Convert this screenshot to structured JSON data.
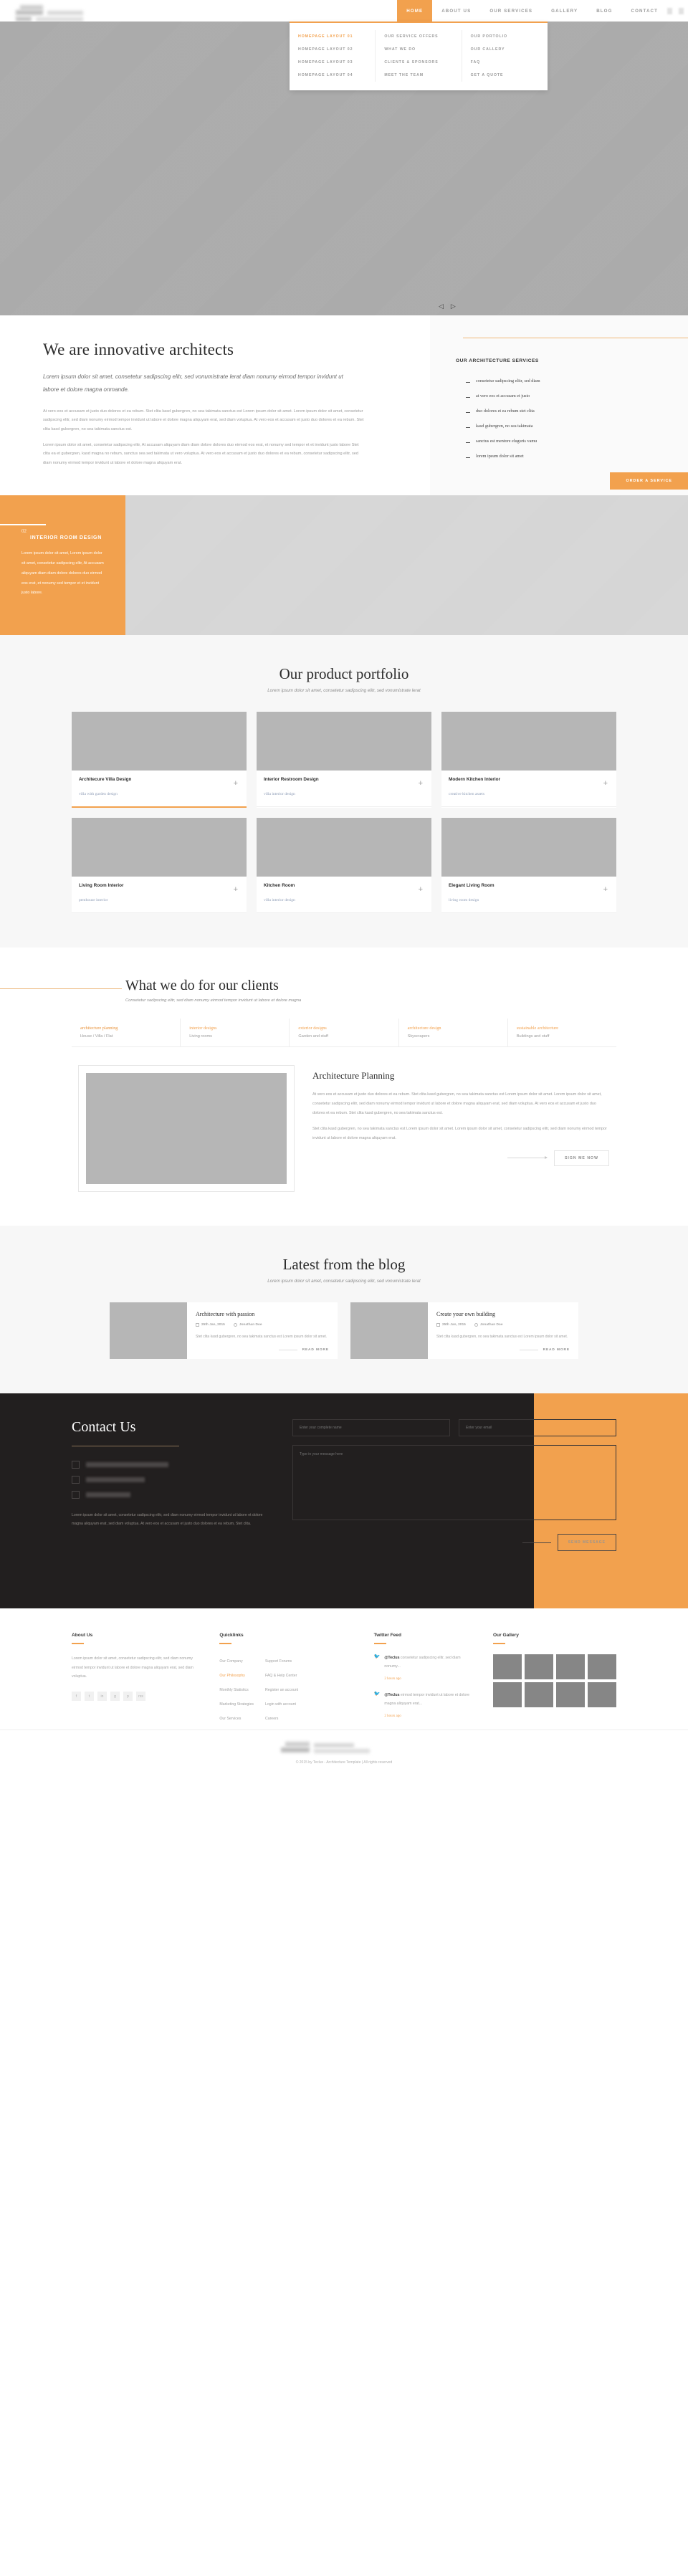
{
  "nav": {
    "items": [
      {
        "label": "HOME",
        "active": true
      },
      {
        "label": "ABOUT US",
        "active": false
      },
      {
        "label": "OUR SERVICES",
        "active": false
      },
      {
        "label": "GALLERY",
        "active": false
      },
      {
        "label": "BLOG",
        "active": false
      },
      {
        "label": "CONTACT",
        "active": false
      }
    ],
    "mega": {
      "col1": [
        "HOMEPAGE LAYOUT 01",
        "HOMEPAGE LAYOUT 02",
        "HOMEPAGE LAYOUT 03",
        "HOMEPAGE LAYOUT 04"
      ],
      "col2": [
        "OUR SERVICE OFFERS",
        "WHAT WE DO",
        "CLIENTS & SPONSORS",
        "MEET THE TEAM"
      ],
      "col3": [
        "OUR PORTOLIO",
        "OUR CALLERY",
        "FAQ",
        "GET A QUOTE"
      ]
    }
  },
  "intro": {
    "title": "We are innovative architects",
    "lead": "Lorem ipsum dolor sit amet, consetetur sadipscing elitr, sed vonumistrate lerat diam nonumy eirmod tempor invidunt ut labore et dolore magna onmande.",
    "body1": "At vero eos et accusam et justo duo dolores et ea rebum. Stet clita kasd gubergren, no sea takimata sanctus est Lorem ipsum dolor sit amet. Lorem ipsum dolor sit amet, consetetur sadipscing elitr, sed diam nonumy eirmod tempor invidunt ut labore et dolore magna aliquyam erat, sed diam voluptua. At vero eos et accusam et justo duo dolores et ea rebum. Stet clita kasd gubergren, no sea takimata sanctus est.",
    "body2": "Lorem ipsum dolor sit amet, consetetur sadipscing elitr, At accusam aliquyam diam diam dolore dolores duo eirmod eos erat, et nonumy sed tempor et et invidunt justo labore Stet clita ea et gubergren, kasd magna no rebum, sanctus sea sed takimata ut vero voluptua. At vero eos et accusam et justo duo dolores et ea rebum, consetetur sadipscing elitr, sed diam nonumy eirmod tempor invidunt ut labore et dolore magna aliquyam erat."
  },
  "slider": {
    "prev": "◁",
    "next": "▷"
  },
  "services": {
    "heading": "OUR ARCHITECTURE SERVICES",
    "items": [
      "consetetur sadipscing elitr, sed diam",
      "at vero eos et accusam et justo",
      "duo dolores et ea rebum stet clita",
      "kasd gubergren, no sea takimata",
      "sanctus est mentore eluguris vamu",
      "lorem ipsum dolor sit amet"
    ],
    "order_button": "ORDER A SERVICE"
  },
  "band": {
    "number": "02",
    "title": "INTERIOR ROOM DESIGN",
    "text": "Lorem ipsum dolor sit amet, Lorem ipsum dolor sit amet, consetetur sadipscing elitr, At accusam aliquyam diam diam dolore dolores duo eirmod eos erat, et nonumy sed tempor et et invidunt justo labore."
  },
  "portfolio": {
    "title": "Our product portfolio",
    "subtitle": "Lorem ipsum dolor sit amet, consetetur sadipscing elitr, sed vonumistrate lerat",
    "plus": "+",
    "cards": [
      {
        "title": "Architecure Villa Design",
        "sub": "villa with garden design",
        "active": true
      },
      {
        "title": "Interior Restroom Design",
        "sub": "villa interior design",
        "active": false
      },
      {
        "title": "Modern Kitchen Interior",
        "sub": "creative kitchen assets",
        "active": false
      },
      {
        "title": "Living Room Interior",
        "sub": "penthouse interior",
        "active": false
      },
      {
        "title": "Kitchen Room",
        "sub": "villa interior design",
        "active": false
      },
      {
        "title": "Elegant Living Room",
        "sub": "living room design",
        "active": false
      }
    ]
  },
  "clients": {
    "title": "What we do for our clients",
    "subtitle": "Consetetur sadipscing elitr, sed diam nonumy eirmod tempor invidunt ut labore et dolore magna",
    "tabs": [
      {
        "label": "architecture planning",
        "sub": "House / Villa / Flat",
        "active": true
      },
      {
        "label": "interior designs",
        "sub": "Living rooms",
        "active": false
      },
      {
        "label": "exterior designs",
        "sub": "Garden and stuff",
        "active": false
      },
      {
        "label": "architecture design",
        "sub": "Skyscrapers",
        "active": false
      },
      {
        "label": "sustainable architecture",
        "sub": "Buildings and stuff",
        "active": false
      }
    ],
    "panel": {
      "title": "Architecture Planning",
      "p1": "At vero eos et accusam et justo duo dolores et ea rebum. Stet clita kasd gubergren, no sea takimata sanctus est Lorem ipsum dolor sit amet. Lorem ipsum dolor sit amet, consetetur sadipscing elitr, sed diam nonumy eirmod tempor invidunt ut labore et dolore magna aliquyam erat, sed diam voluptua. At vero eos et accusam et justo duo dolores et ea rebum. Stet clita kasd gubergren, no sea takimata sanctus est.",
      "p2": "Stet clita kasd gubergren, no sea takimata sanctus est Lorem ipsum dolor sit amet. Lorem ipsum dolor sit amet, consetetur sadipscing elitr, sed diam nonumy eirmod tempor invidunt ut labore et dolore magna aliquyam erat.",
      "button": "SIGN ME NOW"
    }
  },
  "blog": {
    "title": "Latest from the blog",
    "subtitle": "Lorem ipsum dolor sit amet, consetetur sadipscing elitr, sed vonumistrate lerat",
    "readmore": "READ MORE",
    "posts": [
      {
        "title": "Architecture with passion",
        "date": "25th Jan, 2015",
        "author": "Jonathan Doe",
        "text": "Stet clita kasd gubergren, no sea takimata sanctus est Lorem ipsum dolor sit amet."
      },
      {
        "title": "Create your own building",
        "date": "25th Jan, 2015",
        "author": "Jonathan Doe",
        "text": "Stet clita kasd gubergren, no sea takimata sanctus est Lorem ipsum dolor sit amet."
      }
    ]
  },
  "contact": {
    "title": "Contact Us",
    "text": "Lorem ipsum dolor sit amet, consetetur sadipscing elitr, sed diam nonumy eirmod tempor invidunt ut labore et dolore magna aliquyam erat, sed diam voluptua. At vero eos et accusam et justo duo dolores et ea rebum, Stet clita.",
    "name_placeholder": "Enter your complete name",
    "email_placeholder": "Enter your email",
    "message_placeholder": "Type in your message here",
    "send_button": "SEND MESSAGE"
  },
  "footer": {
    "about": {
      "heading": "About Us",
      "text": "Lorem ipsum dolor sit amet, consetetur sadipscing elitr, sed diam nonumy eirmod tempor invidunt ut labore et dolore magna aliquyam erat, sed diam voluptua.",
      "social": [
        "f",
        "t",
        "in",
        "g",
        "p",
        "rss"
      ]
    },
    "quicklinks": {
      "heading": "Quicklinks",
      "col1": [
        {
          "label": "Our Company",
          "active": false
        },
        {
          "label": "Our Philosophy",
          "active": true
        },
        {
          "label": "Monthly Statistics",
          "active": false
        },
        {
          "label": "Marketing Strategies",
          "active": false
        },
        {
          "label": "Our Services",
          "active": false
        }
      ],
      "col2": [
        {
          "label": "Support Forums",
          "active": false
        },
        {
          "label": "FAQ & Help Center",
          "active": false
        },
        {
          "label": "Register an account",
          "active": false
        },
        {
          "label": "Login with account",
          "active": false
        },
        {
          "label": "Careers",
          "active": false
        }
      ]
    },
    "twitter": {
      "heading": "Twitter Feed",
      "items": [
        {
          "handle": "@Teclus",
          "text": " consetetur sadipscing elitr, sed diam nonumy...",
          "time": "2 hours ago"
        },
        {
          "handle": "@Teclus",
          "text": " eirmod tempor invidunt ut labore et dolore magna aliquyam erat...",
          "time": "2 hours ago"
        }
      ]
    },
    "gallery": {
      "heading": "Our Gallery",
      "count": 8
    },
    "copyright": "© 2015 by Teclus - Architecture Template | All rights reserved"
  }
}
